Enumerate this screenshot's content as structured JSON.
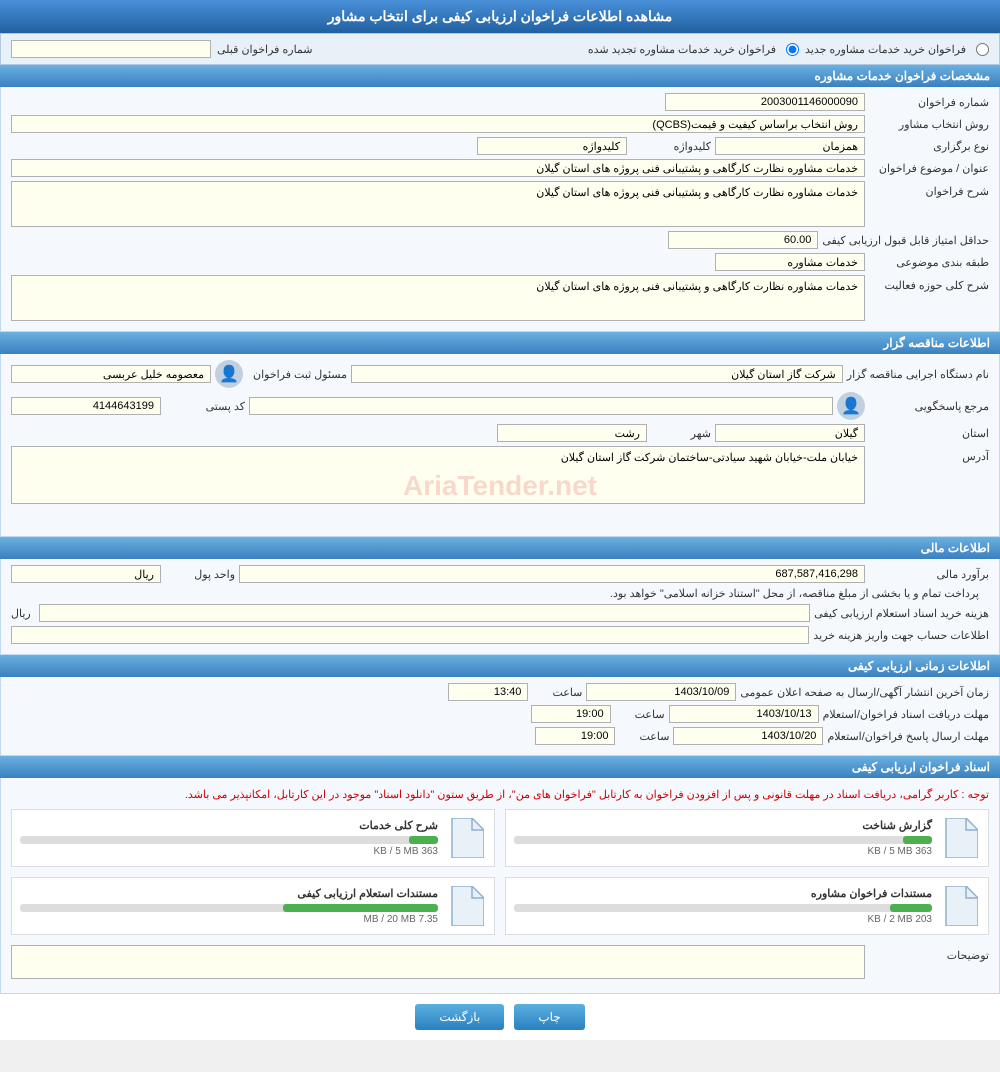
{
  "page": {
    "title": "مشاهده اطلاعات فراخوان ارزیابی کیفی برای انتخاب مشاور",
    "topbar": {
      "radio1": "فراخوان خرید خدمات مشاوره جدید",
      "radio2": "فراخوان خرید خدمات مشاوره تجدید شده",
      "label_prev": "شماره فراخوان قبلی",
      "prev_value": ""
    },
    "tender_specs": {
      "header": "مشخصات فراخوان خدمات مشاوره",
      "fields": {
        "tender_number_label": "شماره فراخوان",
        "tender_number_value": "2003001146000090",
        "selection_method_label": "روش انتخاب مشاور",
        "selection_method_value": "روش انتخاب براساس کیفیت و قیمت(QCBS)",
        "event_type_label": "نوع برگزاری",
        "event_type_value": "همزمان",
        "keyword_label": "کلیدواژه",
        "keyword_value": "کلیدواژه",
        "title_label": "عنوان / موضوع فراخوان",
        "title_value": "خدمات مشاوره نظارت کارگاهی و پشتیبانی فنی پروژه های استان گیلان",
        "description_label": "شرح فراخوان",
        "description_value": "خدمات مشاوره نظارت کارگاهی و پشتیبانی فنی پروژه های استان گیلان",
        "min_score_label": "حداقل امتیاز قابل قبول ارزیابی کیفی",
        "min_score_value": "60.00",
        "category_label": "طبقه بندی موضوعی",
        "category_value": "خدمات مشاوره",
        "activity_desc_label": "شرح کلی حوزه فعالیت",
        "activity_desc_value": "خدمات مشاوره نظارت کارگاهی و پشتیبانی فنی پروژه های استان گیلان"
      }
    },
    "contractor_info": {
      "header": "اطلاعات مناقصه گزار",
      "fields": {
        "org_name_label": "نام دستگاه اجرایی مناقصه گزار",
        "org_name_value": "شرکت گاز استان گیلان",
        "contact_label": "مسئول ثبت فراخوان",
        "contact_value": "معصومه خلیل عربسی",
        "response_ref_label": "مرجع پاسخگویی",
        "response_ref_value": "",
        "postal_code_label": "کد پستی",
        "postal_code_value": "4144643199",
        "province_label": "استان",
        "province_value": "گیلان",
        "city_label": "شهر",
        "city_value": "رشت",
        "address_label": "آدرس",
        "address_value": "خیابان ملت-خیابان شهید سیادتی-ساختمان شرکت گاز استان گیلان"
      }
    },
    "financial_info": {
      "header": "اطلاعات مالی",
      "fields": {
        "budget_label": "برآورد مالی",
        "budget_value": "687,587,416,298",
        "currency_label": "واحد پول",
        "currency_value": "ریال",
        "payment_note": "پرداخت تمام و یا بخشی از مبلغ مناقصه، از محل \"استناد خزانه اسلامی\" خواهد بود.",
        "fee_label": "هزینه خرید اسناد استعلام ارزیابی کیفی",
        "fee_unit": "ریال",
        "fee_value": "",
        "account_label": "اطلاعات حساب جهت واریز هزینه خرید",
        "account_value": ""
      }
    },
    "timing_info": {
      "header": "اطلاعات زمانی ارزیابی کیفی",
      "fields": {
        "publish_label": "زمان آخرین انتشار آگهی/ارسال به صفحه اعلان عمومی",
        "publish_date": "1403/10/09",
        "publish_time": "13:40",
        "receive_label": "مهلت دریافت اسناد فراخوان/استعلام",
        "receive_date": "1403/10/13",
        "receive_time": "19:00",
        "response_label": "مهلت ارسال پاسخ فراخوان/استعلام",
        "response_date": "1403/10/20",
        "response_time": "19:00",
        "time_unit": "ساعت"
      }
    },
    "documents": {
      "header": "اسناد فراخوان ارزیابی کیفی",
      "notice": "توجه : کاربر گرامی، دریافت اسناد در مهلت قانونی و پس از افزودن فراخوان به کارتابل \"فراخوان های من\"، از طریق ستون \"دانلود اسناد\" موجود در این کارتابل، امکانپذیر می باشد.",
      "files": [
        {
          "name": "گزارش شناخت",
          "size_current": "363 KB",
          "size_max": "5 MB",
          "progress_percent": 7
        },
        {
          "name": "شرح کلی خدمات",
          "size_current": "363 KB",
          "size_max": "5 MB",
          "progress_percent": 7
        },
        {
          "name": "مستندات فراخوان مشاوره",
          "size_current": "203 KB",
          "size_max": "2 MB",
          "progress_percent": 10
        },
        {
          "name": "مستندات استعلام ارزیابی کیفی",
          "size_current": "7.35 MB",
          "size_max": "20 MB",
          "progress_percent": 37
        }
      ],
      "desc_label": "توضیحات",
      "desc_value": ""
    },
    "buttons": {
      "print": "چاپ",
      "back": "بازگشت"
    }
  }
}
